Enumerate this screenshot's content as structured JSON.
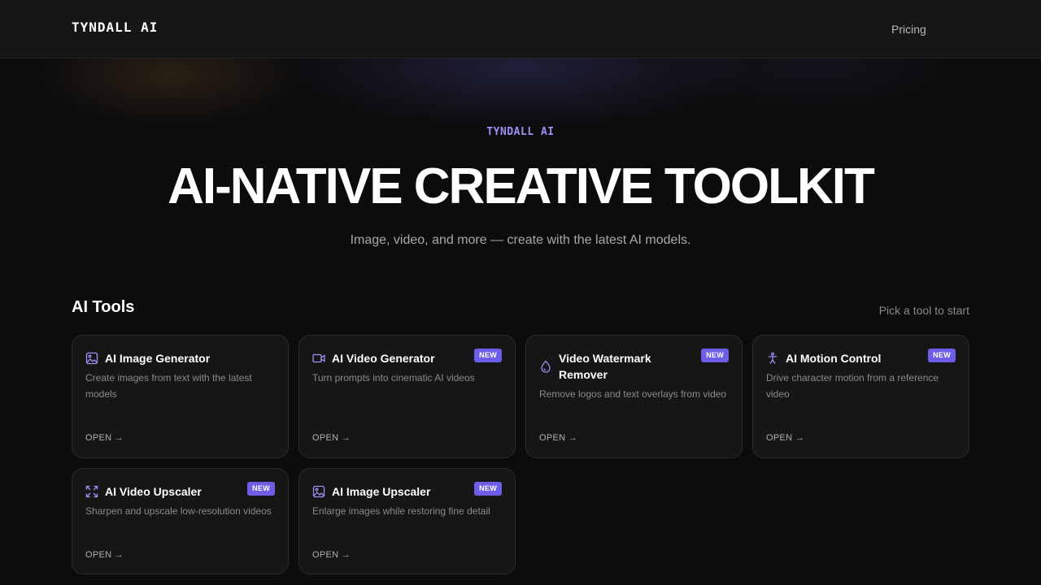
{
  "header": {
    "logo": "TYNDALL AI",
    "nav_pricing": "Pricing"
  },
  "hero": {
    "eyebrow": "TYNDALL AI",
    "title": "AI-NATIVE CREATIVE TOOLKIT",
    "subtitle": "Image, video, and more — create with the latest AI models."
  },
  "tools": {
    "title": "AI Tools",
    "hint": "Pick a tool to start",
    "cards": [
      {
        "icon": "image-icon",
        "title": "AI Image Generator",
        "badge": "",
        "desc": "Create images from text with the latest models",
        "open": "OPEN →"
      },
      {
        "icon": "video-icon",
        "title": "AI Video Generator",
        "badge": "NEW",
        "desc": "Turn prompts into cinematic AI videos",
        "open": "OPEN →"
      },
      {
        "icon": "droplet-icon",
        "title": "Video Watermark Remover",
        "badge": "NEW",
        "desc": "Remove logos and text overlays from video",
        "open": "OPEN →"
      },
      {
        "icon": "person-icon",
        "title": "AI Motion Control",
        "badge": "NEW",
        "desc": "Drive character motion from a reference video",
        "open": "OPEN →"
      },
      {
        "icon": "expand-icon",
        "title": "AI Video Upscaler",
        "badge": "NEW",
        "desc": "Sharpen and upscale low-resolution videos",
        "open": "OPEN →"
      },
      {
        "icon": "image-icon",
        "title": "AI Image Upscaler",
        "badge": "NEW",
        "desc": "Enlarge images while restoring fine detail",
        "open": "OPEN →"
      }
    ]
  },
  "colors": {
    "accent": "#6d5ee8",
    "icon": "#9d93f5",
    "background": "#0c0c0d",
    "card": "#161617"
  }
}
